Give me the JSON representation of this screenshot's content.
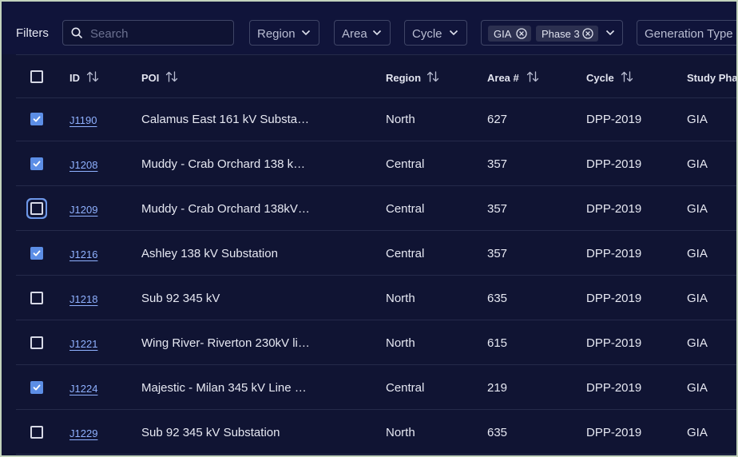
{
  "filters": {
    "title": "Filters",
    "search_placeholder": "Search",
    "region_label": "Region",
    "area_label": "Area",
    "cycle_label": "Cycle",
    "study_phase_chips": [
      "GIA",
      "Phase 3"
    ],
    "generation_type_label": "Generation Type"
  },
  "table": {
    "columns": [
      "ID",
      "POI",
      "Region",
      "Area #",
      "Cycle",
      "Study Pha"
    ],
    "rows": [
      {
        "id": "J1190",
        "poi": "Calamus East 161 kV Substa…",
        "region": "North",
        "area": "627",
        "cycle": "DPP-2019",
        "study_phase": "GIA",
        "checked": true
      },
      {
        "id": "J1208",
        "poi": "Muddy - Crab Orchard 138 k…",
        "region": "Central",
        "area": "357",
        "cycle": "DPP-2019",
        "study_phase": "GIA",
        "checked": true
      },
      {
        "id": "J1209",
        "poi": "Muddy - Crab Orchard 138kV…",
        "region": "Central",
        "area": "357",
        "cycle": "DPP-2019",
        "study_phase": "GIA",
        "checked": false
      },
      {
        "id": "J1216",
        "poi": "Ashley 138 kV Substation",
        "region": "Central",
        "area": "357",
        "cycle": "DPP-2019",
        "study_phase": "GIA",
        "checked": true
      },
      {
        "id": "J1218",
        "poi": "Sub 92 345 kV",
        "region": "North",
        "area": "635",
        "cycle": "DPP-2019",
        "study_phase": "GIA",
        "checked": false
      },
      {
        "id": "J1221",
        "poi": "Wing River- Riverton 230kV li…",
        "region": "North",
        "area": "615",
        "cycle": "DPP-2019",
        "study_phase": "GIA",
        "checked": false
      },
      {
        "id": "J1224",
        "poi": "Majestic - Milan 345 kV Line …",
        "region": "Central",
        "area": "219",
        "cycle": "DPP-2019",
        "study_phase": "GIA",
        "checked": true
      },
      {
        "id": "J1229",
        "poi": "Sub 92 345 kV Substation",
        "region": "North",
        "area": "635",
        "cycle": "DPP-2019",
        "study_phase": "GIA",
        "checked": false
      }
    ]
  },
  "colors": {
    "background": "#101433",
    "checkbox_checked": "#5c8ee6",
    "link": "#8fb1ff"
  }
}
